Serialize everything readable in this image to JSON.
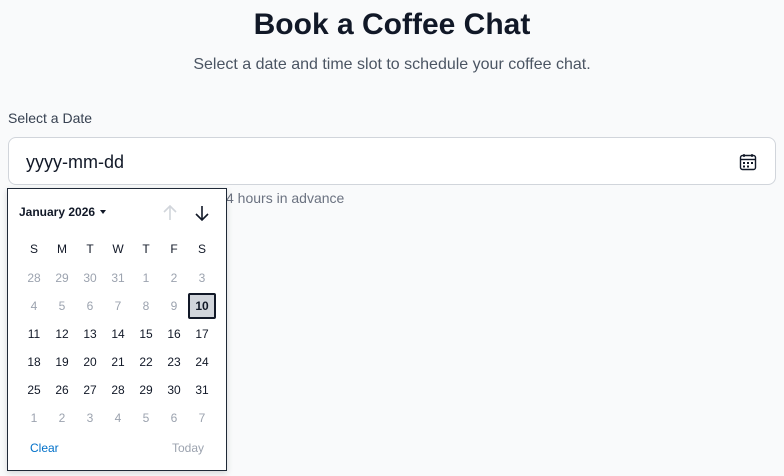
{
  "header": {
    "title": "Book a Coffee Chat",
    "subtitle": "Select a date and time slot to schedule your coffee chat."
  },
  "date_field": {
    "label": "Select a Date",
    "value": "yyyy-mm-dd",
    "icon": "calendar-icon",
    "hint_visible": "4 hours in advance"
  },
  "picker": {
    "month_label": "January 2026",
    "weekdays": [
      "S",
      "M",
      "T",
      "W",
      "T",
      "F",
      "S"
    ],
    "weeks": [
      [
        "28",
        "29",
        "30",
        "31",
        "1",
        "2",
        "3"
      ],
      [
        "4",
        "5",
        "6",
        "7",
        "8",
        "9",
        "10"
      ],
      [
        "11",
        "12",
        "13",
        "14",
        "15",
        "16",
        "17"
      ],
      [
        "18",
        "19",
        "20",
        "21",
        "22",
        "23",
        "24"
      ],
      [
        "25",
        "26",
        "27",
        "28",
        "29",
        "30",
        "31"
      ],
      [
        "1",
        "2",
        "3",
        "4",
        "5",
        "6",
        "7"
      ]
    ],
    "selected_day": "10",
    "clear_label": "Clear",
    "today_label": "Today",
    "colors": {
      "link": "#0070c9",
      "muted": "#9ca3af",
      "selected_bg": "#d1d5db"
    }
  }
}
